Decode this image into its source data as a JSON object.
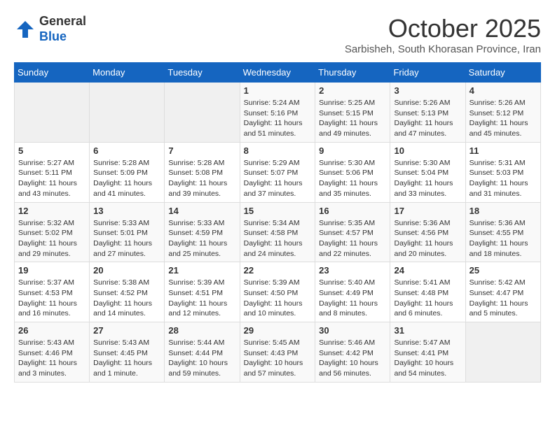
{
  "header": {
    "logo_general": "General",
    "logo_blue": "Blue",
    "month_title": "October 2025",
    "subtitle": "Sarbisheh, South Khorasan Province, Iran"
  },
  "weekdays": [
    "Sunday",
    "Monday",
    "Tuesday",
    "Wednesday",
    "Thursday",
    "Friday",
    "Saturday"
  ],
  "weeks": [
    [
      {
        "day": "",
        "info": ""
      },
      {
        "day": "",
        "info": ""
      },
      {
        "day": "",
        "info": ""
      },
      {
        "day": "1",
        "info": "Sunrise: 5:24 AM\nSunset: 5:16 PM\nDaylight: 11 hours\nand 51 minutes."
      },
      {
        "day": "2",
        "info": "Sunrise: 5:25 AM\nSunset: 5:15 PM\nDaylight: 11 hours\nand 49 minutes."
      },
      {
        "day": "3",
        "info": "Sunrise: 5:26 AM\nSunset: 5:13 PM\nDaylight: 11 hours\nand 47 minutes."
      },
      {
        "day": "4",
        "info": "Sunrise: 5:26 AM\nSunset: 5:12 PM\nDaylight: 11 hours\nand 45 minutes."
      }
    ],
    [
      {
        "day": "5",
        "info": "Sunrise: 5:27 AM\nSunset: 5:11 PM\nDaylight: 11 hours\nand 43 minutes."
      },
      {
        "day": "6",
        "info": "Sunrise: 5:28 AM\nSunset: 5:09 PM\nDaylight: 11 hours\nand 41 minutes."
      },
      {
        "day": "7",
        "info": "Sunrise: 5:28 AM\nSunset: 5:08 PM\nDaylight: 11 hours\nand 39 minutes."
      },
      {
        "day": "8",
        "info": "Sunrise: 5:29 AM\nSunset: 5:07 PM\nDaylight: 11 hours\nand 37 minutes."
      },
      {
        "day": "9",
        "info": "Sunrise: 5:30 AM\nSunset: 5:06 PM\nDaylight: 11 hours\nand 35 minutes."
      },
      {
        "day": "10",
        "info": "Sunrise: 5:30 AM\nSunset: 5:04 PM\nDaylight: 11 hours\nand 33 minutes."
      },
      {
        "day": "11",
        "info": "Sunrise: 5:31 AM\nSunset: 5:03 PM\nDaylight: 11 hours\nand 31 minutes."
      }
    ],
    [
      {
        "day": "12",
        "info": "Sunrise: 5:32 AM\nSunset: 5:02 PM\nDaylight: 11 hours\nand 29 minutes."
      },
      {
        "day": "13",
        "info": "Sunrise: 5:33 AM\nSunset: 5:01 PM\nDaylight: 11 hours\nand 27 minutes."
      },
      {
        "day": "14",
        "info": "Sunrise: 5:33 AM\nSunset: 4:59 PM\nDaylight: 11 hours\nand 25 minutes."
      },
      {
        "day": "15",
        "info": "Sunrise: 5:34 AM\nSunset: 4:58 PM\nDaylight: 11 hours\nand 24 minutes."
      },
      {
        "day": "16",
        "info": "Sunrise: 5:35 AM\nSunset: 4:57 PM\nDaylight: 11 hours\nand 22 minutes."
      },
      {
        "day": "17",
        "info": "Sunrise: 5:36 AM\nSunset: 4:56 PM\nDaylight: 11 hours\nand 20 minutes."
      },
      {
        "day": "18",
        "info": "Sunrise: 5:36 AM\nSunset: 4:55 PM\nDaylight: 11 hours\nand 18 minutes."
      }
    ],
    [
      {
        "day": "19",
        "info": "Sunrise: 5:37 AM\nSunset: 4:53 PM\nDaylight: 11 hours\nand 16 minutes."
      },
      {
        "day": "20",
        "info": "Sunrise: 5:38 AM\nSunset: 4:52 PM\nDaylight: 11 hours\nand 14 minutes."
      },
      {
        "day": "21",
        "info": "Sunrise: 5:39 AM\nSunset: 4:51 PM\nDaylight: 11 hours\nand 12 minutes."
      },
      {
        "day": "22",
        "info": "Sunrise: 5:39 AM\nSunset: 4:50 PM\nDaylight: 11 hours\nand 10 minutes."
      },
      {
        "day": "23",
        "info": "Sunrise: 5:40 AM\nSunset: 4:49 PM\nDaylight: 11 hours\nand 8 minutes."
      },
      {
        "day": "24",
        "info": "Sunrise: 5:41 AM\nSunset: 4:48 PM\nDaylight: 11 hours\nand 6 minutes."
      },
      {
        "day": "25",
        "info": "Sunrise: 5:42 AM\nSunset: 4:47 PM\nDaylight: 11 hours\nand 5 minutes."
      }
    ],
    [
      {
        "day": "26",
        "info": "Sunrise: 5:43 AM\nSunset: 4:46 PM\nDaylight: 11 hours\nand 3 minutes."
      },
      {
        "day": "27",
        "info": "Sunrise: 5:43 AM\nSunset: 4:45 PM\nDaylight: 11 hours\nand 1 minute."
      },
      {
        "day": "28",
        "info": "Sunrise: 5:44 AM\nSunset: 4:44 PM\nDaylight: 10 hours\nand 59 minutes."
      },
      {
        "day": "29",
        "info": "Sunrise: 5:45 AM\nSunset: 4:43 PM\nDaylight: 10 hours\nand 57 minutes."
      },
      {
        "day": "30",
        "info": "Sunrise: 5:46 AM\nSunset: 4:42 PM\nDaylight: 10 hours\nand 56 minutes."
      },
      {
        "day": "31",
        "info": "Sunrise: 5:47 AM\nSunset: 4:41 PM\nDaylight: 10 hours\nand 54 minutes."
      },
      {
        "day": "",
        "info": ""
      }
    ]
  ]
}
